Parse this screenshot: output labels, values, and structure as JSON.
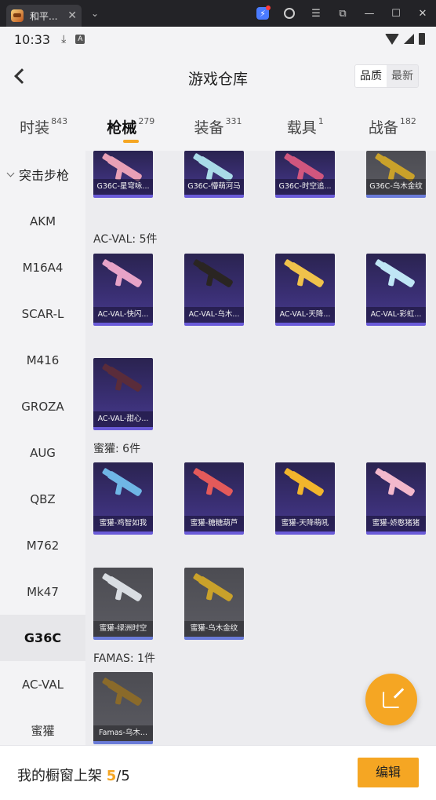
{
  "window": {
    "tab_title": "和平...",
    "close_glyph": "✕",
    "chevron_glyph": "⌄",
    "controls": [
      "bolt-icon",
      "account-icon",
      "menu-icon",
      "screenshot-icon",
      "minimize-icon",
      "maximize-icon",
      "close-icon"
    ]
  },
  "status_bar": {
    "time": "10:33",
    "download_glyph": "⤓",
    "a_badge": "A"
  },
  "header": {
    "title": "游戏仓库",
    "sort_options": [
      "品质",
      "最新"
    ]
  },
  "categories": [
    {
      "label": "时装",
      "count": "843"
    },
    {
      "label": "枪械",
      "count": "279"
    },
    {
      "label": "装备",
      "count": "331"
    },
    {
      "label": "载具",
      "count": "1"
    },
    {
      "label": "战备",
      "count": "182"
    }
  ],
  "sidebar": {
    "group": "突击步枪",
    "items": [
      "AKM",
      "M16A4",
      "SCAR-L",
      "M416",
      "GROZA",
      "AUG",
      "QBZ",
      "M762",
      "Mk47",
      "G36C",
      "AC-VAL",
      "蜜獾"
    ]
  },
  "sections": {
    "top_row": [
      "G36C-星穹咏...",
      "G36C-懵萌河马",
      "G36C-时空追...",
      "G36C-乌木金纹"
    ],
    "acval_label": "AC-VAL: 5件",
    "acval": [
      "AC-VAL-快闪...",
      "AC-VAL-乌木...",
      "AC-VAL-天降...",
      "AC-VAL-彩虹...",
      "AC-VAL-甜心..."
    ],
    "mihuan_label": "蜜獾: 6件",
    "mihuan": [
      "蜜獾-鸡智如我",
      "蜜獾-糖糖葫芦",
      "蜜獾-天降萌吼",
      "蜜獾-娇憨猪猪",
      "蜜獾-绿洲时空",
      "蜜獾-乌木金纹"
    ],
    "famas_label": "FAMAS: 1件",
    "famas": [
      "Famas-乌木..."
    ]
  },
  "footer": {
    "label": "我的橱窗上架",
    "current": "5",
    "total": "/5",
    "edit_label": "编辑"
  },
  "colors": {
    "accent": "#f5a623",
    "epic_card": "#3a2f74",
    "common_card": "#55555b"
  }
}
